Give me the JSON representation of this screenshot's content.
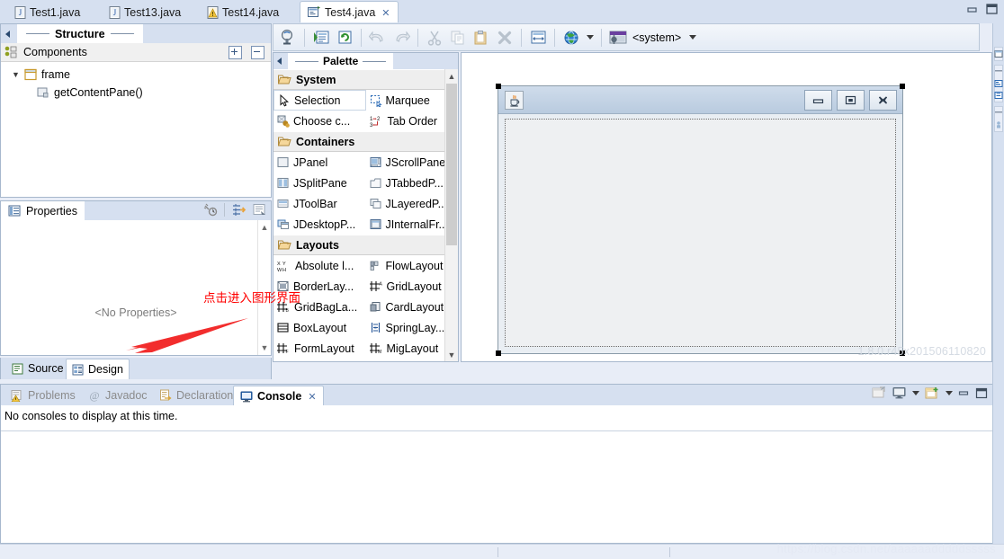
{
  "window": {
    "minimize_label": "Minimize",
    "maximize_label": "Maximize"
  },
  "editor_tabs": [
    {
      "label": "Test1.java",
      "icon": "java-file-icon",
      "active": false,
      "closable": false
    },
    {
      "label": "Test13.java",
      "icon": "java-file-icon",
      "active": false,
      "closable": false
    },
    {
      "label": "Test14.java",
      "icon": "java-warning-file-icon",
      "active": false,
      "closable": false
    },
    {
      "label": "Test4.java",
      "icon": "wb-designer-file-icon",
      "active": true,
      "closable": true
    }
  ],
  "structure": {
    "view_title": "Structure",
    "collapse_icon": "collapse-left-icon",
    "section": {
      "label": "Components",
      "icon": "components-icon",
      "expand_all_label": "Expand All",
      "collapse_all_label": "Collapse All"
    },
    "tree": [
      {
        "label": "frame",
        "icon": "jframe-icon",
        "level": 1,
        "expanded": true
      },
      {
        "label": "getContentPane()",
        "icon": "contentpane-icon",
        "level": 2,
        "expanded": false
      }
    ]
  },
  "properties": {
    "view_title": "Properties",
    "view_icon": "properties-icon",
    "empty_text": "<No Properties>",
    "tools": [
      {
        "name": "show-events-icon",
        "label": "Show events"
      },
      {
        "name": "show-advanced-icon",
        "label": "Show advanced properties"
      },
      {
        "name": "goto-definition-icon",
        "label": "Goto definition"
      }
    ],
    "scroll_up_label": "Scroll up",
    "scroll_down_label": "Scroll down"
  },
  "editor_mode_tabs": [
    {
      "label": "Source",
      "icon": "source-icon",
      "active": false
    },
    {
      "label": "Design",
      "icon": "design-icon",
      "active": true
    }
  ],
  "toolbar": {
    "buttons": [
      {
        "name": "test-button",
        "label": "Test/Preview",
        "icon": "test-preview-icon",
        "enabled": true
      },
      {
        "name": "open-source-button",
        "label": "Open source",
        "icon": "open-source-icon",
        "enabled": true
      },
      {
        "name": "refresh-button",
        "label": "Refresh",
        "icon": "refresh-icon",
        "enabled": true
      },
      {
        "name": "undo-button",
        "label": "Undo",
        "icon": "undo-icon",
        "enabled": false
      },
      {
        "name": "redo-button",
        "label": "Redo",
        "icon": "redo-icon",
        "enabled": false
      },
      {
        "name": "cut-button",
        "label": "Cut",
        "icon": "cut-icon",
        "enabled": false
      },
      {
        "name": "copy-button",
        "label": "Copy",
        "icon": "copy-icon",
        "enabled": false
      },
      {
        "name": "paste-button",
        "label": "Paste",
        "icon": "paste-icon",
        "enabled": false
      },
      {
        "name": "delete-button",
        "label": "Delete",
        "icon": "delete-icon",
        "enabled": false
      },
      {
        "name": "layout-button",
        "label": "Layout assistant",
        "icon": "layout-assist-icon",
        "enabled": true
      },
      {
        "name": "locale-button",
        "label": "Externalize strings",
        "icon": "globe-icon",
        "enabled": true
      }
    ],
    "laf": {
      "label": "<system>",
      "icon": "look-and-feel-icon",
      "dropdown_label": "Select look and feel"
    }
  },
  "palette": {
    "view_title": "Palette",
    "collapse_icon": "collapse-left-icon",
    "categories": [
      {
        "name": "System",
        "icon": "folder-open-icon",
        "items": [
          {
            "label": "Selection",
            "icon": "cursor-icon",
            "selected": true
          },
          {
            "label": "Marquee",
            "icon": "marquee-icon",
            "selected": false
          },
          {
            "label": "Choose c...",
            "icon": "choose-comp-icon",
            "selected": false
          },
          {
            "label": "Tab Order",
            "icon": "tab-order-icon",
            "selected": false
          }
        ]
      },
      {
        "name": "Containers",
        "icon": "folder-open-icon",
        "items": [
          {
            "label": "JPanel",
            "icon": "jpanel-icon",
            "selected": false
          },
          {
            "label": "JScrollPane",
            "icon": "jscrollpane-icon",
            "selected": false
          },
          {
            "label": "JSplitPane",
            "icon": "jsplitpane-icon",
            "selected": false
          },
          {
            "label": "JTabbedP...",
            "icon": "jtabbedpane-icon",
            "selected": false
          },
          {
            "label": "JToolBar",
            "icon": "jtoolbar-icon",
            "selected": false
          },
          {
            "label": "JLayeredP...",
            "icon": "jlayeredpane-icon",
            "selected": false
          },
          {
            "label": "JDesktopP...",
            "icon": "jdesktoppane-icon",
            "selected": false
          },
          {
            "label": "JInternalFr...",
            "icon": "jinternalframe-icon",
            "selected": false
          }
        ]
      },
      {
        "name": "Layouts",
        "icon": "folder-open-icon",
        "items": [
          {
            "label": "Absolute l...",
            "icon": "absolute-layout-icon",
            "selected": false
          },
          {
            "label": "FlowLayout",
            "icon": "flow-layout-icon",
            "selected": false
          },
          {
            "label": "BorderLay...",
            "icon": "border-layout-icon",
            "selected": false
          },
          {
            "label": "GridLayout",
            "icon": "grid-layout-icon",
            "selected": false
          },
          {
            "label": "GridBagLa...",
            "icon": "gridbag-layout-icon",
            "selected": false
          },
          {
            "label": "CardLayout",
            "icon": "card-layout-icon",
            "selected": false
          },
          {
            "label": "BoxLayout",
            "icon": "box-layout-icon",
            "selected": false
          },
          {
            "label": "SpringLay...",
            "icon": "spring-layout-icon",
            "selected": false
          },
          {
            "label": "FormLayout",
            "icon": "form-layout-icon",
            "selected": false
          },
          {
            "label": "MigLayout",
            "icon": "mig-layout-icon",
            "selected": false
          }
        ]
      }
    ]
  },
  "design_canvas": {
    "preview_frame": {
      "title": "",
      "app_icon": "java-cup-icon",
      "window_buttons": [
        {
          "name": "minimize-button",
          "label": "Minimize",
          "icon": "minimize-icon"
        },
        {
          "name": "maximize-button",
          "label": "Maximize",
          "icon": "restore-icon"
        },
        {
          "name": "close-button",
          "label": "Close",
          "icon": "close-icon"
        }
      ],
      "content_pane_label": "getContentPane()"
    },
    "watermark": "1.8.0.r45x201506110820"
  },
  "console_panel": {
    "tabs": [
      {
        "label": "Problems",
        "icon": "problems-icon",
        "active": false,
        "closable": false
      },
      {
        "label": "Javadoc",
        "icon": "javadoc-icon",
        "active": false,
        "closable": false
      },
      {
        "label": "Declaration",
        "icon": "declaration-icon",
        "active": false,
        "closable": false
      },
      {
        "label": "Console",
        "icon": "console-icon",
        "active": true,
        "closable": true
      }
    ],
    "message": "No consoles to display at this time.",
    "tools": [
      {
        "name": "clear-console-icon",
        "label": "Clear Console"
      },
      {
        "name": "display-console-icon",
        "label": "Display Selected Console"
      },
      {
        "name": "display-console-caret",
        "label": "Display Selected Console menu"
      },
      {
        "name": "open-console-icon",
        "label": "Open Console"
      },
      {
        "name": "open-console-caret",
        "label": "Open Console menu"
      },
      {
        "name": "minimize-view-icon",
        "label": "Minimize"
      },
      {
        "name": "maximize-view-icon",
        "label": "Maximize"
      }
    ]
  },
  "right_rail": {
    "groups": [
      {
        "icons": [
          "restore-view-icon"
        ]
      },
      {
        "icons": [
          "view-title-icon",
          "package-explorer-icon",
          "hierarchy-icon"
        ]
      },
      {
        "icons": [
          "view-title-icon",
          "outline-icon"
        ]
      }
    ]
  },
  "annotation": {
    "text": "点击进入图形界面",
    "color": "#ff0000",
    "arrow_name": "pointer-arrow"
  },
  "page_watermark": "https://blog.csdn.net/aaaaaadddddsssss"
}
